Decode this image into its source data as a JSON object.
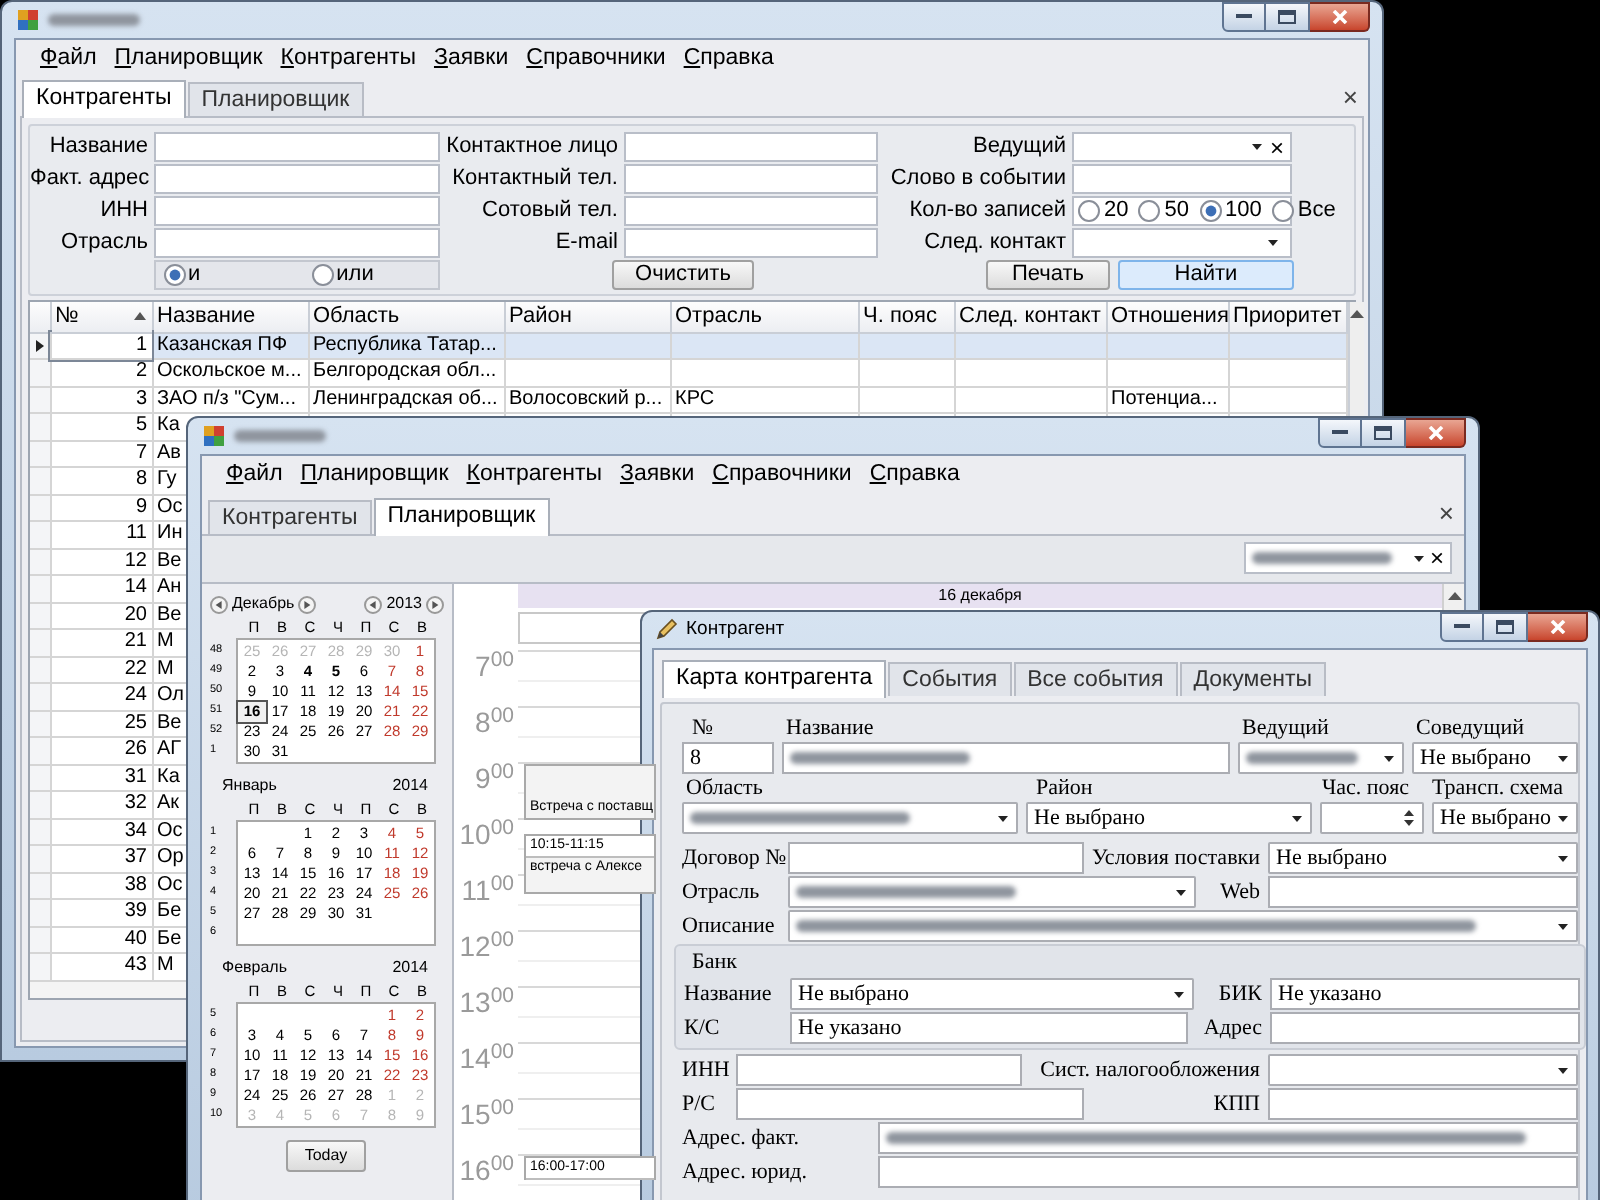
{
  "main_window": {
    "title_blurred": true,
    "menu": [
      "Файл",
      "Планировщик",
      "Контрагенты",
      "Заявки",
      "Справочники",
      "Справка"
    ],
    "tabs": [
      {
        "label": "Контрагенты",
        "selected": true
      },
      {
        "label": "Планировщик",
        "selected": false
      }
    ],
    "tab_close": "×",
    "filter_columns": [
      [
        {
          "label": "Название",
          "kind": "input"
        },
        {
          "label": "Факт. адрес",
          "kind": "input"
        },
        {
          "label": "ИНН",
          "kind": "input"
        },
        {
          "label": "Отрасль",
          "kind": "input"
        }
      ],
      [
        {
          "label": "Контактное лицо",
          "kind": "input"
        },
        {
          "label": "Контактный тел.",
          "kind": "input"
        },
        {
          "label": "Сотовый тел.",
          "kind": "input"
        },
        {
          "label": "E-mail",
          "kind": "input"
        }
      ],
      [
        {
          "label": "Ведущий",
          "kind": "combo_clear",
          "clear": "×"
        },
        {
          "label": "Слово в событии",
          "kind": "input"
        },
        {
          "label": "Кол-во записей",
          "kind": "radio",
          "options": [
            {
              "label": "20",
              "selected": false
            },
            {
              "label": "50",
              "selected": false
            },
            {
              "label": "100",
              "selected": true
            },
            {
              "label": "Все",
              "selected": false
            }
          ]
        },
        {
          "label": "След. контакт",
          "kind": "combo"
        }
      ]
    ],
    "logic_options": [
      {
        "label": "и",
        "selected": true
      },
      {
        "label": "или",
        "selected": false
      }
    ],
    "buttons": [
      {
        "label": "Очистить",
        "highlighted": false
      },
      {
        "label": "Печать",
        "highlighted": false
      },
      {
        "label": "Найти",
        "highlighted": true
      }
    ],
    "table": {
      "columns": [
        {
          "label": "№",
          "sorted": true
        },
        {
          "label": "Название",
          "sorted": false
        },
        {
          "label": "Область",
          "sorted": false
        },
        {
          "label": "Район",
          "sorted": false
        },
        {
          "label": "Отрасль",
          "sorted": false
        },
        {
          "label": "Ч. пояс",
          "sorted": false
        },
        {
          "label": "След. контакт",
          "sorted": false
        },
        {
          "label": "Отношения",
          "sorted": false
        },
        {
          "label": "Приоритет",
          "sorted": false
        }
      ],
      "rows": [
        {
          "number": "1",
          "name": "Казанская ПФ",
          "region": "Республика Татар...",
          "selected": true
        },
        {
          "number": "2",
          "name": "Оскольское м...",
          "region": "Белгородская обл...",
          "selected": false
        },
        {
          "number": "3",
          "name": "ЗАО п/з \"Сум...",
          "region": "Ленинградская об...",
          "district": "Волосовский р...",
          "industry": "КРС",
          "relation": "Потенциа...",
          "selected": false
        },
        {
          "number": "5",
          "name": "Ка",
          "selected": false
        },
        {
          "number": "7",
          "name": "Ав",
          "selected": false
        },
        {
          "number": "8",
          "name": "Гу",
          "selected": false
        },
        {
          "number": "9",
          "name": "Ос",
          "selected": false
        },
        {
          "number": "11",
          "name": "Ин",
          "selected": false
        },
        {
          "number": "12",
          "name": "Ве",
          "selected": false
        },
        {
          "number": "14",
          "name": "Ан",
          "selected": false
        },
        {
          "number": "20",
          "name": "Ве",
          "selected": false
        },
        {
          "number": "21",
          "name": "М",
          "selected": false
        },
        {
          "number": "22",
          "name": "М",
          "selected": false
        },
        {
          "number": "24",
          "name": "Ол",
          "selected": false
        },
        {
          "number": "25",
          "name": "Ве",
          "selected": false
        },
        {
          "number": "26",
          "name": "АГ",
          "selected": false
        },
        {
          "number": "31",
          "name": "Ка",
          "selected": false
        },
        {
          "number": "32",
          "name": "Ак",
          "selected": false
        },
        {
          "number": "34",
          "name": "Ос",
          "selected": false
        },
        {
          "number": "37",
          "name": "Ор",
          "selected": false
        },
        {
          "number": "38",
          "name": "Ос",
          "selected": false
        },
        {
          "number": "39",
          "name": "Бе",
          "selected": false
        },
        {
          "number": "40",
          "name": "Бе",
          "selected": false
        },
        {
          "number": "43",
          "name": "М",
          "selected": false
        }
      ]
    }
  },
  "planner_window": {
    "title_blurred": true,
    "menu": [
      "Файл",
      "Планировщик",
      "Контрагенты",
      "Заявки",
      "Справочники",
      "Справка"
    ],
    "tabs": [
      {
        "label": "Контрагенты",
        "selected": false
      },
      {
        "label": "Планировщик",
        "selected": true
      }
    ],
    "tab_close": "×",
    "user_filter": {
      "blurred": true,
      "clear": "×"
    },
    "calendars": [
      {
        "month": "Декабрь",
        "year": "2013",
        "arrows": true,
        "weekdays": [
          "П",
          "В",
          "С",
          "Ч",
          "П",
          "С",
          "В"
        ],
        "weeks": [
          {
            "number": "48",
            "days": [
              {
                "text": "25",
                "kind": "other"
              },
              {
                "text": "26",
                "kind": "other"
              },
              {
                "text": "27",
                "kind": "other"
              },
              {
                "text": "28",
                "kind": "other"
              },
              {
                "text": "29",
                "kind": "other"
              },
              {
                "text": "30",
                "kind": "other"
              },
              {
                "text": "1",
                "kind": "weekend"
              }
            ]
          },
          {
            "number": "49",
            "days": [
              {
                "text": "2",
                "kind": "day"
              },
              {
                "text": "3",
                "kind": "day"
              },
              {
                "text": "4",
                "kind": "busy"
              },
              {
                "text": "5",
                "kind": "busy"
              },
              {
                "text": "6",
                "kind": "day"
              },
              {
                "text": "7",
                "kind": "weekend"
              },
              {
                "text": "8",
                "kind": "weekend"
              }
            ]
          },
          {
            "number": "50",
            "days": [
              {
                "text": "9",
                "kind": "day"
              },
              {
                "text": "10",
                "kind": "day"
              },
              {
                "text": "11",
                "kind": "day"
              },
              {
                "text": "12",
                "kind": "day"
              },
              {
                "text": "13",
                "kind": "day"
              },
              {
                "text": "14",
                "kind": "weekend"
              },
              {
                "text": "15",
                "kind": "weekend"
              }
            ]
          },
          {
            "number": "51",
            "days": [
              {
                "text": "16",
                "kind": "today"
              },
              {
                "text": "17",
                "kind": "day"
              },
              {
                "text": "18",
                "kind": "day"
              },
              {
                "text": "19",
                "kind": "day"
              },
              {
                "text": "20",
                "kind": "day"
              },
              {
                "text": "21",
                "kind": "weekend"
              },
              {
                "text": "22",
                "kind": "weekend"
              }
            ]
          },
          {
            "number": "52",
            "days": [
              {
                "text": "23",
                "kind": "day"
              },
              {
                "text": "24",
                "kind": "day"
              },
              {
                "text": "25",
                "kind": "day"
              },
              {
                "text": "26",
                "kind": "day"
              },
              {
                "text": "27",
                "kind": "day"
              },
              {
                "text": "28",
                "kind": "weekend"
              },
              {
                "text": "29",
                "kind": "weekend"
              }
            ]
          },
          {
            "number": "1",
            "days": [
              {
                "text": "30",
                "kind": "day"
              },
              {
                "text": "31",
                "kind": "day"
              },
              {
                "kind": "blank"
              },
              {
                "kind": "blank"
              },
              {
                "kind": "blank"
              },
              {
                "kind": "blank"
              },
              {
                "kind": "blank"
              }
            ]
          }
        ]
      },
      {
        "month": "Январь",
        "year": "2014",
        "arrows": false,
        "weekdays": [
          "П",
          "В",
          "С",
          "Ч",
          "П",
          "С",
          "В"
        ],
        "weeks": [
          {
            "number": "1",
            "days": [
              {
                "kind": "blank"
              },
              {
                "kind": "blank"
              },
              {
                "text": "1",
                "kind": "day"
              },
              {
                "text": "2",
                "kind": "day"
              },
              {
                "text": "3",
                "kind": "day"
              },
              {
                "text": "4",
                "kind": "weekend"
              },
              {
                "text": "5",
                "kind": "weekend"
              }
            ]
          },
          {
            "number": "2",
            "days": [
              {
                "text": "6",
                "kind": "day"
              },
              {
                "text": "7",
                "kind": "day"
              },
              {
                "text": "8",
                "kind": "day"
              },
              {
                "text": "9",
                "kind": "day"
              },
              {
                "text": "10",
                "kind": "day"
              },
              {
                "text": "11",
                "kind": "weekend"
              },
              {
                "text": "12",
                "kind": "weekend"
              }
            ]
          },
          {
            "number": "3",
            "days": [
              {
                "text": "13",
                "kind": "day"
              },
              {
                "text": "14",
                "kind": "day"
              },
              {
                "text": "15",
                "kind": "day"
              },
              {
                "text": "16",
                "kind": "day"
              },
              {
                "text": "17",
                "kind": "day"
              },
              {
                "text": "18",
                "kind": "weekend"
              },
              {
                "text": "19",
                "kind": "weekend"
              }
            ]
          },
          {
            "number": "4",
            "days": [
              {
                "text": "20",
                "kind": "day"
              },
              {
                "text": "21",
                "kind": "day"
              },
              {
                "text": "22",
                "kind": "day"
              },
              {
                "text": "23",
                "kind": "day"
              },
              {
                "text": "24",
                "kind": "day"
              },
              {
                "text": "25",
                "kind": "weekend"
              },
              {
                "text": "26",
                "kind": "weekend"
              }
            ]
          },
          {
            "number": "5",
            "days": [
              {
                "text": "27",
                "kind": "day"
              },
              {
                "text": "28",
                "kind": "day"
              },
              {
                "text": "29",
                "kind": "day"
              },
              {
                "text": "30",
                "kind": "day"
              },
              {
                "text": "31",
                "kind": "day"
              },
              {
                "kind": "blank"
              },
              {
                "kind": "blank"
              }
            ]
          },
          {
            "number": "6",
            "days": [
              {
                "kind": "blank"
              },
              {
                "kind": "blank"
              },
              {
                "kind": "blank"
              },
              {
                "kind": "blank"
              },
              {
                "kind": "blank"
              },
              {
                "kind": "blank"
              },
              {
                "kind": "blank"
              }
            ]
          }
        ]
      },
      {
        "month": "Февраль",
        "year": "2014",
        "arrows": false,
        "weekdays": [
          "П",
          "В",
          "С",
          "Ч",
          "П",
          "С",
          "В"
        ],
        "weeks": [
          {
            "number": "5",
            "days": [
              {
                "kind": "blank"
              },
              {
                "kind": "blank"
              },
              {
                "kind": "blank"
              },
              {
                "kind": "blank"
              },
              {
                "kind": "blank"
              },
              {
                "text": "1",
                "kind": "weekend"
              },
              {
                "text": "2",
                "kind": "weekend"
              }
            ]
          },
          {
            "number": "6",
            "days": [
              {
                "text": "3",
                "kind": "day"
              },
              {
                "text": "4",
                "kind": "day"
              },
              {
                "text": "5",
                "kind": "day"
              },
              {
                "text": "6",
                "kind": "day"
              },
              {
                "text": "7",
                "kind": "day"
              },
              {
                "text": "8",
                "kind": "weekend"
              },
              {
                "text": "9",
                "kind": "weekend"
              }
            ]
          },
          {
            "number": "7",
            "days": [
              {
                "text": "10",
                "kind": "day"
              },
              {
                "text": "11",
                "kind": "day"
              },
              {
                "text": "12",
                "kind": "day"
              },
              {
                "text": "13",
                "kind": "day"
              },
              {
                "text": "14",
                "kind": "day"
              },
              {
                "text": "15",
                "kind": "weekend"
              },
              {
                "text": "16",
                "kind": "weekend"
              }
            ]
          },
          {
            "number": "8",
            "days": [
              {
                "text": "17",
                "kind": "day"
              },
              {
                "text": "18",
                "kind": "day"
              },
              {
                "text": "19",
                "kind": "day"
              },
              {
                "text": "20",
                "kind": "day"
              },
              {
                "text": "21",
                "kind": "day"
              },
              {
                "text": "22",
                "kind": "weekend"
              },
              {
                "text": "23",
                "kind": "weekend"
              }
            ]
          },
          {
            "number": "9",
            "days": [
              {
                "text": "24",
                "kind": "day"
              },
              {
                "text": "25",
                "kind": "day"
              },
              {
                "text": "26",
                "kind": "day"
              },
              {
                "text": "27",
                "kind": "day"
              },
              {
                "text": "28",
                "kind": "day"
              },
              {
                "text": "1",
                "kind": "other"
              },
              {
                "text": "2",
                "kind": "other"
              }
            ]
          },
          {
            "number": "10",
            "days": [
              {
                "text": "3",
                "kind": "other"
              },
              {
                "text": "4",
                "kind": "other"
              },
              {
                "text": "5",
                "kind": "other"
              },
              {
                "text": "6",
                "kind": "other"
              },
              {
                "text": "7",
                "kind": "other"
              },
              {
                "text": "8",
                "kind": "other"
              },
              {
                "text": "9",
                "kind": "other"
              }
            ]
          }
        ]
      }
    ],
    "today_button": "Today",
    "day_header": "16 декабря",
    "hours": [
      {
        "label": "7$^{00}$"
      },
      {
        "label": "8$^{00}$"
      },
      {
        "label": "9$^{00}$",
        "events": [
          {
            "title": "Встреча с поставщ"
          }
        ]
      },
      {
        "label": "10$^{00}$",
        "events": [
          {
            "time": "10:15-11:15",
            "title": "встреча с Алексе"
          }
        ]
      },
      {
        "label": "11$^{00}$"
      },
      {
        "label": "12$^{00}$"
      },
      {
        "label": "13$^{00}$"
      },
      {
        "label": "14$^{00}$"
      },
      {
        "label": "15$^{00}$"
      },
      {
        "label": "16$^{00}$",
        "events": [
          {
            "time": "16:00-17:00"
          }
        ]
      }
    ]
  },
  "contractor_window": {
    "title": "Контрагент",
    "tabs": [
      {
        "label": "Карта контрагента",
        "selected": true
      },
      {
        "label": "События",
        "selected": false
      },
      {
        "label": "Все события",
        "selected": false
      },
      {
        "label": "Документы",
        "selected": false
      }
    ],
    "fields": {
      "number": {
        "label": "№",
        "kind": "input",
        "blurred": false,
        "value": "8"
      },
      "name": {
        "label": "Название",
        "kind": "input",
        "blurred": true
      },
      "lead": {
        "label": "Ведущий",
        "kind": "combo",
        "blurred": true
      },
      "co_lead": {
        "label": "Соведущий",
        "kind": "combo",
        "blurred": false,
        "value": "Не выбрано"
      },
      "region": {
        "label": "Область",
        "kind": "combo",
        "blurred": true
      },
      "district": {
        "label": "Район",
        "kind": "combo",
        "blurred": false,
        "value": "Не выбрано"
      },
      "timezone": {
        "label": "Час. пояс",
        "kind": "spinner",
        "blurred": false
      },
      "transport": {
        "label": "Трансп. схема",
        "kind": "combo",
        "blurred": false,
        "value": "Не выбрано"
      },
      "contract": {
        "label": "Договор №",
        "kind": "input",
        "blurred": false
      },
      "delivery": {
        "label": "Условия поставки",
        "kind": "combo",
        "blurred": false,
        "value": "Не выбрано"
      },
      "industry": {
        "label": "Отрасль",
        "kind": "combo",
        "blurred": true
      },
      "web": {
        "label": "Web",
        "kind": "input",
        "blurred": false
      },
      "description": {
        "label": "Описание",
        "kind": "combo",
        "blurred": true
      },
      "inn": {
        "label": "ИНН",
        "kind": "input",
        "blurred": false
      },
      "tax_system": {
        "label": "Сист. налогообложения",
        "kind": "combo",
        "blurred": false
      },
      "rs": {
        "label": "Р/С",
        "kind": "input",
        "blurred": false
      },
      "kpp": {
        "label": "КПП",
        "kind": "input",
        "blurred": false
      },
      "address_actual": {
        "label": "Адрес. факт.",
        "kind": "input",
        "blurred": true
      },
      "address_legal": {
        "label": "Адрес. юрид.",
        "kind": "input",
        "blurred": false
      }
    },
    "bank": {
      "title": "Банк",
      "fields": [
        {
          "label": "Название",
          "kind": "combo",
          "blurred": false,
          "value": "Не выбрано"
        },
        {
          "label": "БИК",
          "kind": "input",
          "blurred": false,
          "value": "Не указано"
        },
        {
          "label": "К/С",
          "kind": "input",
          "blurred": false,
          "value": "Не указано"
        },
        {
          "label": "Адрес",
          "kind": "input",
          "blurred": false
        }
      ]
    }
  }
}
